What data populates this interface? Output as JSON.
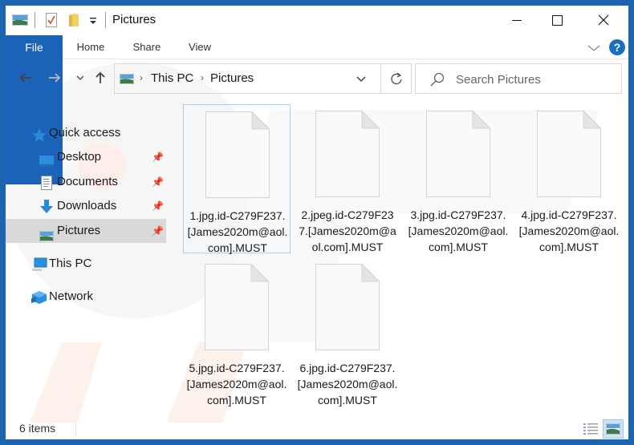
{
  "window": {
    "title": "Pictures",
    "controls": {
      "minimize": "minimize",
      "maximize": "maximize",
      "close": "close"
    }
  },
  "quick_access_toolbar": {
    "icons": [
      "pictures-folder-icon",
      "properties-icon",
      "new-folder-icon",
      "customize-dropdown-icon"
    ]
  },
  "ribbon": {
    "tabs": [
      {
        "label": "File",
        "active": true
      },
      {
        "label": "Home"
      },
      {
        "label": "Share"
      },
      {
        "label": "View"
      }
    ],
    "help_label": "?"
  },
  "navigation": {
    "back": "←",
    "forward": "→",
    "recent": "⌄",
    "up": "↑",
    "breadcrumb": [
      "This PC",
      "Pictures"
    ],
    "breadcrumb_sep": "›",
    "refresh": "↻"
  },
  "search": {
    "placeholder": "Search Pictures",
    "value": ""
  },
  "sidebar": {
    "items": [
      {
        "label": "Quick access",
        "icon": "star-icon"
      },
      {
        "label": "Desktop",
        "icon": "desktop-icon",
        "pinned": true
      },
      {
        "label": "Documents",
        "icon": "documents-icon",
        "pinned": true
      },
      {
        "label": "Downloads",
        "icon": "downloads-icon",
        "pinned": true
      },
      {
        "label": "Pictures",
        "icon": "pictures-icon",
        "pinned": true,
        "selected": true
      },
      {
        "label": "This PC",
        "icon": "computer-icon"
      },
      {
        "label": "Network",
        "icon": "network-icon"
      }
    ]
  },
  "files": [
    {
      "name": "1.jpg.id-C279F237.[James2020m@aol.com].MUST",
      "selected": true
    },
    {
      "name": "2.jpeg.id-C279F237.[James2020m@aol.com].MUST"
    },
    {
      "name": "3.jpg.id-C279F237.[James2020m@aol.com].MUST"
    },
    {
      "name": "4.jpg.id-C279F237.[James2020m@aol.com].MUST"
    },
    {
      "name": "5.jpg.id-C279F237.[James2020m@aol.com].MUST"
    },
    {
      "name": "6.jpg.id-C279F237.[James2020m@aol.com].MUST"
    }
  ],
  "status": {
    "item_count": "6 items"
  },
  "colors": {
    "accent": "#1a63b8",
    "frame": "#1c63b0",
    "selection": "#d9d9d9",
    "file_selection_border": "#a8cff0"
  }
}
